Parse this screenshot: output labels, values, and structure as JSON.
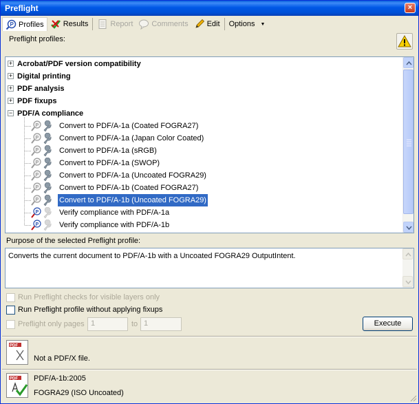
{
  "window": {
    "title": "Preflight",
    "close_glyph": "×"
  },
  "toolbar": {
    "profiles": "Profiles",
    "results": "Results",
    "report": "Report",
    "comments": "Comments",
    "edit": "Edit",
    "options": "Options",
    "options_arrow": "▼"
  },
  "profiles_label": "Preflight profiles:",
  "tree": {
    "categories": [
      {
        "label": "Acrobat/PDF version compatibility",
        "glyph": "+"
      },
      {
        "label": "Digital printing",
        "glyph": "+"
      },
      {
        "label": "PDF analysis",
        "glyph": "+"
      },
      {
        "label": "PDF fixups",
        "glyph": "+"
      },
      {
        "label": "PDF/A compliance",
        "glyph": "−"
      }
    ],
    "items": [
      "Convert to PDF/A-1a (Coated FOGRA27)",
      "Convert to PDF/A-1a (Japan Color Coated)",
      "Convert to PDF/A-1a (sRGB)",
      "Convert to PDF/A-1a (SWOP)",
      "Convert to PDF/A-1a (Uncoated FOGRA29)",
      "Convert to PDF/A-1b (Coated FOGRA27)",
      "Convert to PDF/A-1b (Uncoated FOGRA29)",
      "Verify compliance with PDF/A-1a",
      "Verify compliance with PDF/A-1b"
    ],
    "selected_index": 6
  },
  "purpose": {
    "label": "Purpose of the selected Preflight profile:",
    "text": "Converts the current document to PDF/A-1b with a Uncoated FOGRA29 OutputIntent."
  },
  "options": {
    "visible_layers": "Run Preflight checks for visible layers only",
    "without_fixups": "Run Preflight profile without applying fixups",
    "only_pages": "Preflight only pages",
    "to": "to",
    "from_page": "1",
    "to_page": "1"
  },
  "execute_label": "Execute",
  "status": {
    "pdfx_badge": "PDF",
    "pdfx_text": "Not a PDF/X file.",
    "pdfa_line1": "PDF/A-1b:2005",
    "pdfa_line2": "FOGRA29 (ISO Uncoated)",
    "pdfa_badge": "PDF"
  },
  "colors": {
    "titlebar": "#0058e6",
    "selection": "#316ac5",
    "window_bg": "#ece9d8"
  }
}
